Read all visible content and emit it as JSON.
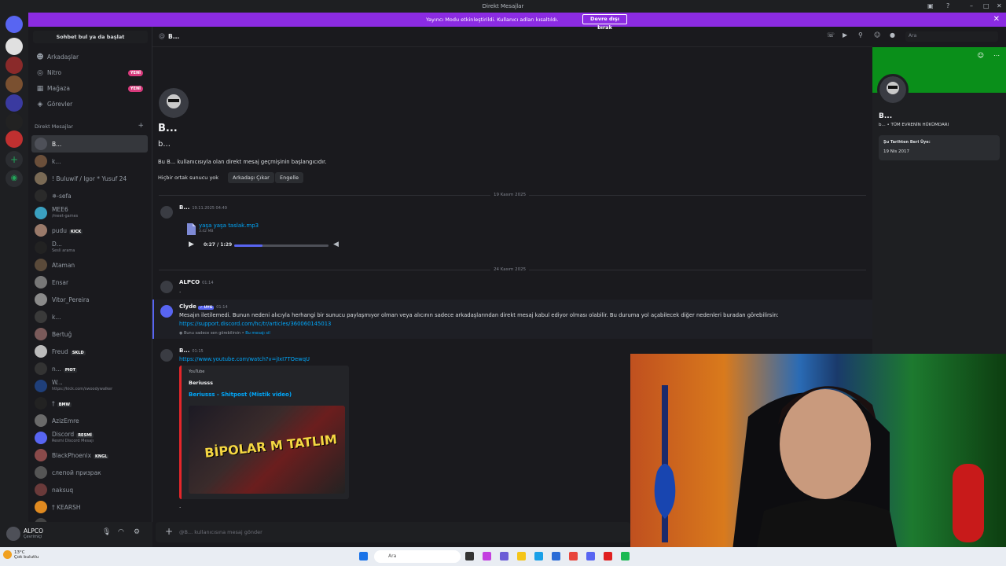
{
  "titlebar": {
    "title": "Direkt Mesajlar"
  },
  "banner": {
    "text": "Yayıncı Modu etkinleştirildi. Kullanıcı adları kısaltıldı.",
    "button": "Devre dışı bırak"
  },
  "sidebar": {
    "search": "Sohbet bul ya da başlat",
    "nav": [
      {
        "label": "Arkadaşlar",
        "badge": ""
      },
      {
        "label": "Nitro",
        "badge": "YENİ"
      },
      {
        "label": "Mağaza",
        "badge": "YENİ"
      },
      {
        "label": "Görevler",
        "badge": ""
      }
    ],
    "dm_header": "Direkt Mesajlar",
    "dms": [
      {
        "name": "B...",
        "sub": "",
        "tag": ""
      },
      {
        "name": "k...",
        "sub": "",
        "tag": ""
      },
      {
        "name": "! Buluwif / Igor * Yusuf 24",
        "sub": "",
        "tag": ""
      },
      {
        "name": "✵-sefa",
        "sub": "",
        "tag": ""
      },
      {
        "name": "MEE6",
        "sub": "/meet-games",
        "tag": ""
      },
      {
        "name": "pudu",
        "sub": "",
        "tag": "KICK"
      },
      {
        "name": "D...",
        "sub": "Sesli arama",
        "tag": ""
      },
      {
        "name": "Ataman",
        "sub": "",
        "tag": ""
      },
      {
        "name": "Ensar",
        "sub": "",
        "tag": ""
      },
      {
        "name": "Vitor_Pereira",
        "sub": "",
        "tag": ""
      },
      {
        "name": "k...",
        "sub": "",
        "tag": ""
      },
      {
        "name": "Bertuğ",
        "sub": "",
        "tag": ""
      },
      {
        "name": "Freud",
        "sub": "",
        "tag": "SKLD"
      },
      {
        "name": "n...",
        "sub": "",
        "tag": "PIOT"
      },
      {
        "name": "W...",
        "sub": "https://kick.com/swoodywalker",
        "tag": ""
      },
      {
        "name": "†",
        "sub": "",
        "tag": "BMW"
      },
      {
        "name": "AzizEmre",
        "sub": "",
        "tag": ""
      },
      {
        "name": "Discord",
        "sub": "Resmi Discord Mesajı",
        "tag": "RESMİ"
      },
      {
        "name": "BlackPhoenix",
        "sub": "",
        "tag": "KNGL"
      },
      {
        "name": "слепой призрак",
        "sub": "",
        "tag": ""
      },
      {
        "name": "naksuq",
        "sub": "",
        "tag": ""
      },
      {
        "name": "† KEARSH",
        "sub": "",
        "tag": ""
      },
      {
        "name": "Yusuf",
        "sub": "",
        "tag": "TXTR"
      }
    ]
  },
  "user": {
    "name": "ALPCO",
    "status": "Çevrimiçi"
  },
  "chat": {
    "header_name": "B...",
    "big_name": "B...",
    "big_sub": "b...",
    "intro": "Bu B... kullanıcısıyla olan direkt mesaj geçmişinin başlangıcıdır.",
    "no_mutual": "Hiçbir ortak sunucu yok",
    "remove_friend": "Arkadaşı Çıkar",
    "block": "Engelle",
    "date1": "19 Kasım 2025",
    "date2": "24 Kasım 2025",
    "msg1": {
      "author": "B...",
      "time": "19.11.2025 04:49",
      "file": "yaşa yaşa taslak.mp3",
      "size": "3.42 MB",
      "player_time": "0:27 / 1:29",
      "progress": 0.3
    },
    "msg2": {
      "author": "ALPCO",
      "time": "01:14",
      "text": "."
    },
    "clyde": {
      "author": "Clyde",
      "badge": "✓ UYG",
      "time": "01:14",
      "text": "Mesajın iletilemedi. Bunun nedeni alıcıyla herhangi bir sunucu paylaşmıyor olman veya alıcının sadece arkadaşlarından direkt mesaj kabul ediyor olması olabilir. Bu duruma yol açabilecek diğer nedenleri buradan görebilirsin:",
      "link": "https://support.discord.com/hc/tr/articles/360060145013",
      "note": "Bunu sadece sen görebilirsin •",
      "dismiss": "Bu mesajı sil"
    },
    "msg3": {
      "author": "B...",
      "time": "01:15",
      "link": "https://www.youtube.com/watch?v=jIxI7TOewqU",
      "embed_source": "YouTube",
      "embed_author": "Beriusss",
      "embed_title": "Beriusss - Shitpost (Mistik video)",
      "thumb_text": "BİPOLAR M TATLIM",
      "trailing": "."
    },
    "composer_placeholder": "@B... kullanıcısına mesaj gönder"
  },
  "header_search": "Ara",
  "profile": {
    "name": "B...",
    "sub": "b... • TÜM EVRENİN HÜKÜMDARI",
    "member_since_label": "Şu Tarihten Beri Üye:",
    "member_since": "19 Nis 2017"
  },
  "taskbar": {
    "weather_temp": "13°C",
    "weather_desc": "Çok bulutlu",
    "search": "Ara"
  },
  "colors": {
    "accent": "#5865f2",
    "banner": "#8b2be2",
    "link": "#00a8fc",
    "profile_banner": "#0a8f1a"
  }
}
